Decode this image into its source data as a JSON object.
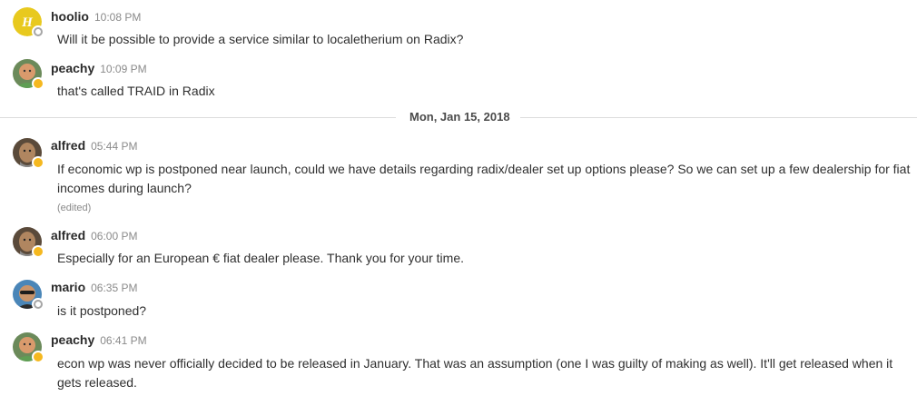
{
  "messages": [
    {
      "user": "hoolio",
      "time": "10:08 PM",
      "text": "Will it be possible to provide a service similar to localetherium on Radix?",
      "avatar_letter": "H",
      "avatar_color": "#e8c91e",
      "status": "offline"
    },
    {
      "user": "peachy",
      "time": "10:09 PM",
      "text": "that's called TRAID in Radix",
      "status": "away"
    },
    {
      "user": "alfred",
      "time": "05:44 PM",
      "text": "If economic wp is postponed near launch, could we have details regarding radix/dealer set up options please? So we can set up a few dealership for fiat incomes during launch?",
      "edited": "(edited)",
      "status": "away"
    },
    {
      "user": "alfred",
      "time": "06:00 PM",
      "text": "Especially for an European € fiat dealer please. Thank you for your time.",
      "status": "away"
    },
    {
      "user": "mario",
      "time": "06:35 PM",
      "text": "is it postponed?",
      "status": "offline"
    },
    {
      "user": "peachy",
      "time": "06:41 PM",
      "text": "econ wp was never officially decided to be released in January.  That was an assumption (one I was guilty of making as well).  It'll get released when it gets released.",
      "status": "away"
    }
  ],
  "date_divider": "Mon, Jan 15, 2018",
  "colors": {
    "away": "#f5b81f",
    "offline_ring": "#a6a6a6",
    "divider": "#dcdcdc"
  }
}
